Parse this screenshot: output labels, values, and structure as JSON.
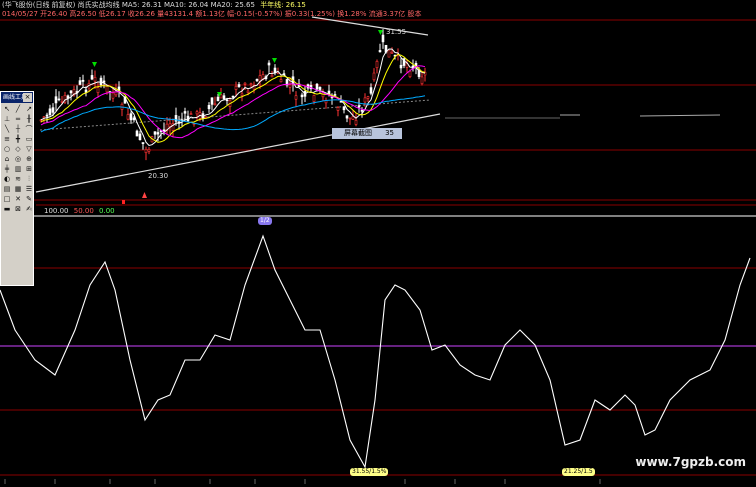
{
  "header": {
    "line1": "(华飞股份(日线 前复权) 尚氏实战均线  MA5: 26.31  MA10: 26.04  MA20: 25.65",
    "line1_right": "半年线: 26.15",
    "line2": "014/05/27 开26.40 高26.50 低26.17 收26.26 量43131.4 额1.13亿 幅-0.15(-0.57%) 振0.33(1.25%) 换1.28% 流通3.37亿 股本"
  },
  "price_labels": {
    "high": "31.55",
    "low": "20.30"
  },
  "popup": {
    "label": "屏幕截图",
    "value": "35"
  },
  "indicator_header": {
    "v1": "100.00",
    "v2": "50.00",
    "v3": "0.00"
  },
  "toolbox": {
    "title": "画线工具",
    "close": "×",
    "tools": [
      "↖",
      "╱",
      "↗",
      "⊥",
      "═",
      "╫",
      "╲",
      "┼",
      "⌒",
      "≡",
      "╋",
      "▭",
      "○",
      "◇",
      "▽",
      "⌂",
      "◎",
      "⊕",
      "╪",
      "▥",
      "⊞",
      "◐",
      "≋",
      "⫶",
      "▤",
      "▦",
      "☰",
      "□",
      "✕",
      "✎",
      "▬",
      "⊠",
      "✍"
    ]
  },
  "top_tag": "1/2",
  "bottom_tags": [
    "31.55/1.5%",
    "21.25/1.5"
  ],
  "watermark": "www.7gpzb.com",
  "colors": {
    "candle_up": "#ff3333",
    "candle_down": "#ffffff",
    "ma5": "#ffffff",
    "ma10": "#ffff00",
    "ma20": "#ff00ff",
    "ma_long": "#00aaff",
    "osc": "#ffffff",
    "mid_line": "#cc44ff",
    "grid_red": "#8a0000"
  }
}
